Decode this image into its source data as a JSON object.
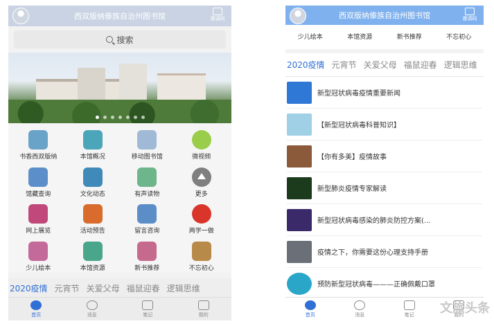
{
  "app": {
    "title": "西双版纳傣族自治州图书馆",
    "scan_label": "邀请码"
  },
  "left": {
    "search_label": "搜索",
    "grid": [
      {
        "label": "书香西双版纳",
        "icon": "book-leaf-icon"
      },
      {
        "label": "本馆概况",
        "icon": "library-building-icon"
      },
      {
        "label": "移动图书馆",
        "icon": "tree-books-icon"
      },
      {
        "label": "微视频",
        "icon": "film-reel-icon"
      },
      {
        "label": "馆藏查询",
        "icon": "trophy-cup-icon"
      },
      {
        "label": "文化动态",
        "icon": "dancer-icon"
      },
      {
        "label": "有声读物",
        "icon": "sound-book-icon"
      },
      {
        "label": "更多",
        "icon": "more-up-icon"
      },
      {
        "label": "网上展览",
        "icon": "exhibition-icon"
      },
      {
        "label": "活动预告",
        "icon": "bonfire-icon"
      },
      {
        "label": "留言咨询",
        "icon": "pen-message-icon"
      },
      {
        "label": "两学一做",
        "icon": "party-emblem-icon"
      },
      {
        "label": "少儿绘本",
        "icon": "children-icon"
      },
      {
        "label": "本馆资源",
        "icon": "resource-fish-icon"
      },
      {
        "label": "新书推荐",
        "icon": "new-book-icon"
      },
      {
        "label": "不忘初心",
        "icon": "deer-icon"
      }
    ]
  },
  "tabs": [
    "2020疫情",
    "元宵节",
    "关爱父母",
    "福鼠迎春",
    "逻辑思维"
  ],
  "bottom_nav": [
    "首页",
    "消息",
    "笔记",
    "我的"
  ],
  "right": {
    "quicklinks": [
      "少儿绘本",
      "本馆资源",
      "新书推荐",
      "不忘初心"
    ],
    "news": [
      {
        "title": "新型冠状病毒疫情重要新闻",
        "thumb_color": "#2f78d6"
      },
      {
        "title": "【新型冠状病毒科普知识】",
        "thumb_color": "#9fd0e6"
      },
      {
        "title": "【你有多美】疫情故事",
        "thumb_color": "#8a5a3a"
      },
      {
        "title": "新型肺炎疫情专家解读",
        "thumb_color": "#1c3a1c"
      },
      {
        "title": "新型冠状病毒感染的肺炎防控方案(...",
        "thumb_color": "#3a2a6a"
      },
      {
        "title": "疫情之下，你需要这份心理支持手册",
        "thumb_color": "#6a6f78"
      },
      {
        "title": "预防新型冠状病毒———正确佩戴口罩",
        "thumb_color": "#2aa6c8"
      }
    ]
  },
  "watermark": "文旅头条",
  "colors": {
    "accent": "#2f6fd6",
    "titlebar_right": "#7fb1ee"
  }
}
